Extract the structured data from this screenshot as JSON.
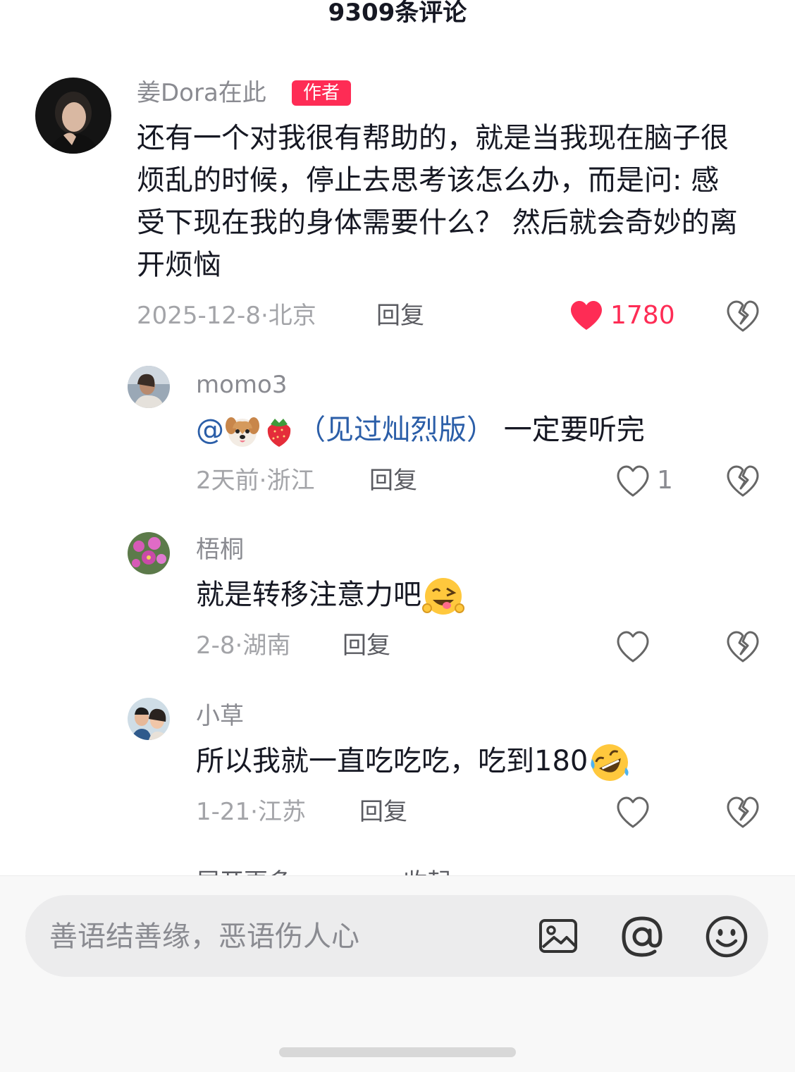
{
  "header": {
    "title": "9309条评论"
  },
  "comments": [
    {
      "username": "姜Dora在此",
      "badge": "作者",
      "text": "还有一个对我很有帮助的，就是当我现在脑子很烦乱的时候，停止去思考该怎么办，而是问: 感受下现在我的身体需要什么？ 然后就会奇妙的离开烦恼",
      "meta": "2025-12-8·北京",
      "reply": "回复",
      "likes": "1780",
      "liked": true
    },
    {
      "username": "momo3",
      "mention_prefix": "@",
      "mention_suffix": "（见过灿烈版）",
      "text": " 一定要听完",
      "meta": "2天前·浙江",
      "reply": "回复",
      "likes": "1",
      "liked": false
    },
    {
      "username": "梧桐",
      "text": "就是转移注意力吧",
      "meta": "2-8·湖南",
      "reply": "回复",
      "likes": "",
      "liked": false
    },
    {
      "username": "小草",
      "text": "所以我就一直吃吃吃，吃到180",
      "meta": "1-21·江苏",
      "reply": "回复",
      "likes": "",
      "liked": false
    }
  ],
  "expand": {
    "more": "展开更多",
    "collapse": "收起"
  },
  "input": {
    "placeholder": "善语结善缘，恶语伤人心"
  },
  "icons": {
    "image": "image-icon",
    "mention": "at-icon",
    "emoji": "emoji-icon",
    "like": "heart-icon",
    "dislike": "broken-heart-icon"
  },
  "colors": {
    "like_active": "#fe2c55",
    "mention": "#2b5ea8",
    "badge": "#fe2c55"
  }
}
